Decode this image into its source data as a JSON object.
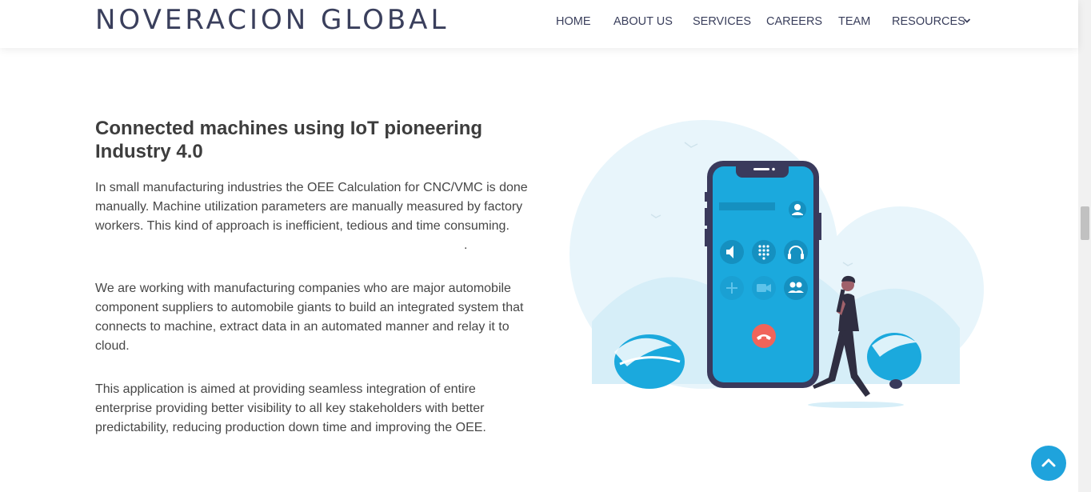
{
  "header": {
    "logo": "NOVERACION GLOBAL",
    "nav": [
      {
        "label": "HOME"
      },
      {
        "label": "ABOUT US"
      },
      {
        "label": "SERVICES"
      },
      {
        "label": "CAREERS"
      },
      {
        "label": "TEAM"
      },
      {
        "label": "RESOURCES"
      }
    ]
  },
  "main": {
    "heading": "Connected machines using IoT pioneering Industry 4.0",
    "paragraphs": [
      "In small manufacturing industries the OEE Calculation for CNC/VMC is done manually. Machine utilization parameters are manually measured by factory workers. This kind of approach is inefficient, tedious and time consuming.",
      "We are working with manufacturing companies who are major automobile component suppliers to automobile giants to build an integrated system that connects to machine, extract data in an automated manner and relay it to cloud.",
      "This application is aimed at providing seamless integration of entire enterprise providing better visibility to all key stakeholders with better predictability, reducing production down time and improving the OEE."
    ],
    "stray_dot": "."
  },
  "colors": {
    "accent": "#1fa3dc",
    "phone_screen": "#1ba9dd",
    "phone_frame": "#3a3a5c",
    "end_call": "#f0645a",
    "bg_circle": "#e8f5fb"
  },
  "icons": [
    "chevron-down-icon",
    "speaker-icon",
    "keypad-icon",
    "headphones-icon",
    "plus-icon",
    "video-icon",
    "contacts-icon",
    "end-call-icon",
    "avatar-icon",
    "arrow-up-icon"
  ]
}
